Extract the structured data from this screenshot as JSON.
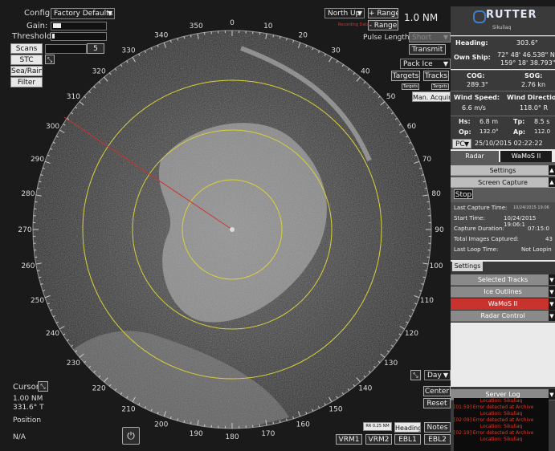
{
  "config": {
    "label": "Config:",
    "value": "Factory Defaults"
  },
  "gain_label": "Gain:",
  "threshold_label": "Threshold:",
  "scans": {
    "label": "Scans",
    "value": "5"
  },
  "stc_label": "STC",
  "sea_rain_label": "Sea/Rain",
  "filter_label": "Filter",
  "orientation": {
    "value": "North Up"
  },
  "range": {
    "plus_label": "+ Range",
    "minus_label": "- Range",
    "value": "1.0 NM",
    "recording": "Recording Data"
  },
  "pulse_length": {
    "label": "Pulse Length:",
    "value": "Short"
  },
  "transmit_label": "Transmit",
  "pack_ice": {
    "value": "Pack Ice"
  },
  "targets_label": "Targets",
  "tracks_label": "Tracks",
  "small_target_labels": [
    "Targets",
    "Targets"
  ],
  "man_acquire_label": "Man. Acquire",
  "cursor": {
    "label": "Cursor",
    "range": "1.00 NM",
    "bearing": "331.6° T",
    "position_label": "Position",
    "position_value": "N/A"
  },
  "day": {
    "value": "Day"
  },
  "center_label": "Center",
  "reset_label": "Reset",
  "rr_label": "RR 0.25 NM",
  "heading_button": "Heading",
  "notes_label": "Notes",
  "bottom_buttons": [
    "VRM1",
    "VRM2",
    "EBL1",
    "EBL2"
  ],
  "bearing_ticks": [
    "0",
    "10",
    "20",
    "30",
    "40",
    "50",
    "60",
    "70",
    "80",
    "90",
    "100",
    "110",
    "120",
    "130",
    "140",
    "150",
    "160",
    "170",
    "180",
    "190",
    "200",
    "210",
    "220",
    "230",
    "240",
    "250",
    "260",
    "270",
    "280",
    "290",
    "300",
    "310",
    "320",
    "330",
    "340",
    "350"
  ],
  "panel": {
    "brand": "RUTTER",
    "brand_sub": "Sikuliaq",
    "heading": {
      "label": "Heading:",
      "value": "303.6°"
    },
    "own_ship": {
      "label": "Own Ship:",
      "lat": "72° 48' 46.538\" N",
      "lon": "159° 18' 38.793\" W"
    },
    "cog": {
      "label": "COG:",
      "value": "289.3°"
    },
    "sog": {
      "label": "SOG:",
      "value": "2.76 kn"
    },
    "wind_speed": {
      "label": "Wind Speed:",
      "value": "6.6 m/s"
    },
    "wind_direction": {
      "label": "Wind Direction",
      "value": "118.0° R"
    },
    "hs": {
      "label": "Hs:",
      "value": "6.8 m"
    },
    "tp": {
      "label": "Tp:",
      "value": "8.5 s"
    },
    "op": {
      "label": "Op:",
      "value": "132.0°"
    },
    "ap": {
      "label": "Ap:",
      "value": "112.0"
    },
    "pc": {
      "value": "PC"
    },
    "datetime": "25/10/2015 02:22:22",
    "tabs": [
      "Radar",
      "WaMoS II"
    ],
    "settings_label": "Settings",
    "screen_capture_label": "Screen Capture",
    "stop_label": "Stop",
    "last_capture": {
      "label": "Last Capture Time:",
      "value": "10/24/2015 19:06"
    },
    "start_time": {
      "label": "Start Time:",
      "value": "10/24/2015 19:06:1"
    },
    "duration": {
      "label": "Capture Duration:",
      "value": "07:15:0"
    },
    "total_images": {
      "label": "Total Images Captured:",
      "value": "43"
    },
    "last_loop": {
      "label": "Last Loop Time:",
      "value": "Not Loopin"
    },
    "settings_tab": "Settings",
    "menu": [
      "Selected Tracks",
      "Ice Outlines",
      "WaMoS II",
      "Radar Control"
    ],
    "server_log_label": "Server Log",
    "log": [
      {
        "loc": "Location: Sikuliaq",
        "msg": "[01:59] Error detected at Archive"
      },
      {
        "loc": "Location: Sikuliaq",
        "msg": "[02:09] Error detected at Archive"
      },
      {
        "loc": "Location: Sikuliaq",
        "msg": "[02:19] Error detected at Archive"
      },
      {
        "loc": "Location: Sikuliaq",
        "msg": ""
      }
    ]
  },
  "colors": {
    "ring": "#d8d23a",
    "heading_line": "#d03030",
    "panel_bg": "#eaeaea",
    "menu_red": "#c9332d"
  }
}
